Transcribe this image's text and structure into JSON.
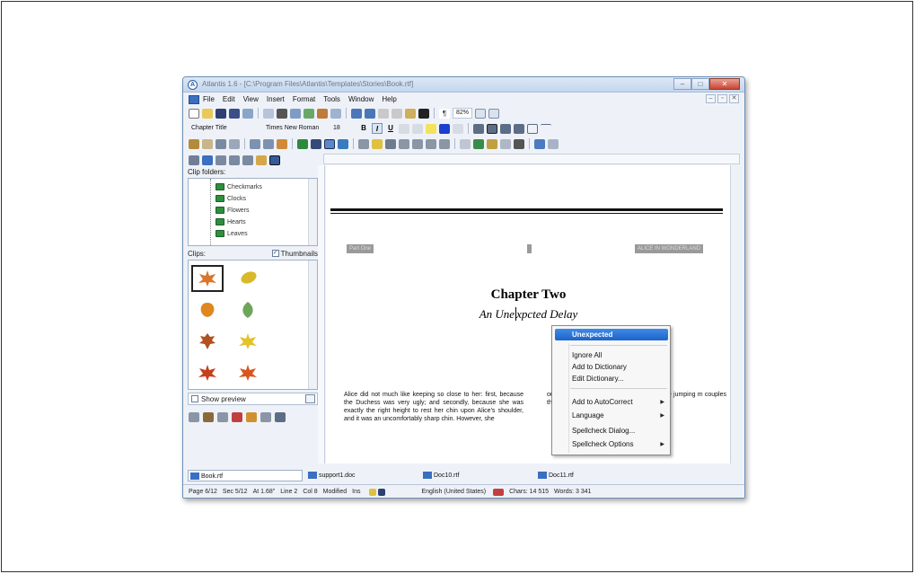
{
  "window": {
    "title": "Atlantis 1.6 - [C:\\Program Files\\Atlantis\\Templates\\Stories\\Book.rtf]",
    "app_letter": "A",
    "min_label": "–",
    "max_label": "□",
    "close_label": "✕"
  },
  "menu": {
    "items": [
      "File",
      "Edit",
      "View",
      "Insert",
      "Format",
      "Tools",
      "Window",
      "Help"
    ],
    "mdi": [
      "–",
      "▫",
      "✕"
    ]
  },
  "toolbar": {
    "zoom": "82%",
    "style": "Chapter Title",
    "font": "Times New Roman",
    "size": "18",
    "bold": "B",
    "italic": "I",
    "underline": "U"
  },
  "left_pane": {
    "clip_folders_label": "Clip folders:",
    "folders": [
      "Checkmarks",
      "Clocks",
      "Flowers",
      "Hearts",
      "Leaves"
    ],
    "clips_label": "Clips:",
    "thumbnails_label": "Thumbnails",
    "thumbnails_checked": "✓",
    "show_preview_label": "Show preview"
  },
  "document": {
    "header_left": "Part One",
    "header_right": "ALICE IN WONDERLAND",
    "chapter_title": "Chapter Two",
    "subtitle_before": "An Une",
    "subtitle_after": "xpcted Delay",
    "body_col1": "Alice did not much like keeping so close to her: first, because the Duchess was very ugly; and secondly, because she was exactly the right height to rest her chin upon Alice's shoulder, and it was an uncomfortably sharp chin. However, she",
    "body_col2": "ou d two and fo these came th re ten of th e jumping m couples th th hearts."
  },
  "context_menu": {
    "suggestion": "Unexpected",
    "items": [
      "Ignore All",
      "Add to Dictionary",
      "Edit Dictionary...",
      "Add to AutoCorrect",
      "Language",
      "Spellcheck Dialog...",
      "Spellcheck Options"
    ],
    "submenu_arrow": "▶"
  },
  "tabs": [
    "Book.rtf",
    "support1.doc",
    "Doc10.rtf",
    "Doc11.rtf"
  ],
  "status": {
    "page": "Page 6/12",
    "sec": "Sec 5/12",
    "at": "At 1.68\"",
    "line": "Line 2",
    "col": "Col 8",
    "modified": "Modified",
    "ins": "Ins",
    "language": "English (United States)",
    "chars": "Chars: 14 515",
    "words": "Words: 3 341"
  },
  "colors": {
    "menu_highlight": "#1d63c9",
    "title_gradient": "#c4d6ee",
    "folder_green": "#2f8f3c",
    "close_red": "#c9452f"
  }
}
